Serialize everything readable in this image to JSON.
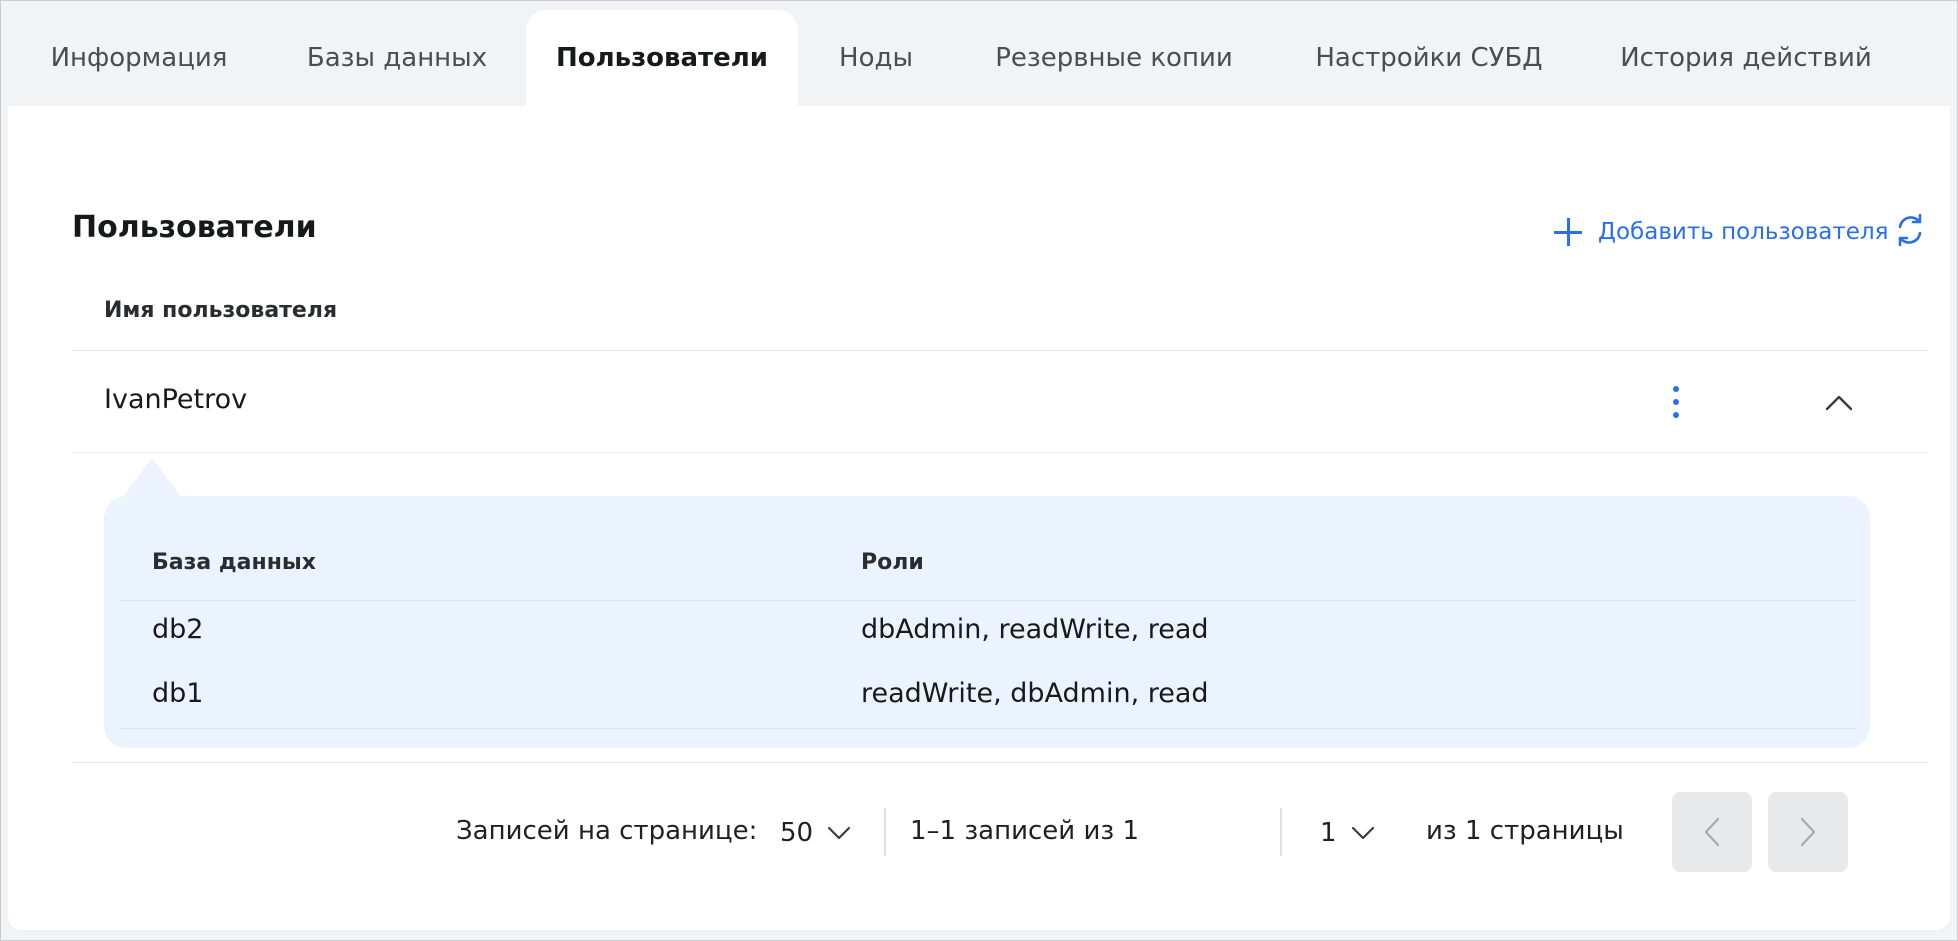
{
  "tabs": [
    {
      "label": "Информация",
      "active": false
    },
    {
      "label": "Базы данных",
      "active": false
    },
    {
      "label": "Пользователи",
      "active": true
    },
    {
      "label": "Ноды",
      "active": false
    },
    {
      "label": "Резервные копии",
      "active": false
    },
    {
      "label": "Настройки СУБД",
      "active": false
    },
    {
      "label": "История действий",
      "active": false
    }
  ],
  "users_section": {
    "title": "Пользователи",
    "add_user_label": "Добавить пользователя",
    "column_header": "Имя пользователя",
    "rows": [
      {
        "name": "IvanPetrov"
      }
    ]
  },
  "expanded": {
    "headers": {
      "database": "База данных",
      "roles": "Роли"
    },
    "rows": [
      {
        "database": "db2",
        "roles": "dbAdmin, readWrite, read"
      },
      {
        "database": "db1",
        "roles": "readWrite, dbAdmin, read"
      }
    ]
  },
  "pagination": {
    "per_page_label": "Записей на странице:",
    "per_page_value": "50",
    "records_summary": "1–1 записей из 1",
    "page_value": "1",
    "pages_summary": "из 1 страницы"
  },
  "colors": {
    "accent": "#2a6ee8",
    "panel_bg": "#ebf4fe",
    "page_bg": "#f2f3f5"
  },
  "icons": {
    "add": "plus-icon",
    "refresh": "refresh-icon",
    "row_menu": "kebab-menu-icon",
    "collapse": "chevron-up-icon",
    "dropdown": "chevron-down-icon",
    "prev": "chevron-left-icon",
    "next": "chevron-right-icon"
  }
}
